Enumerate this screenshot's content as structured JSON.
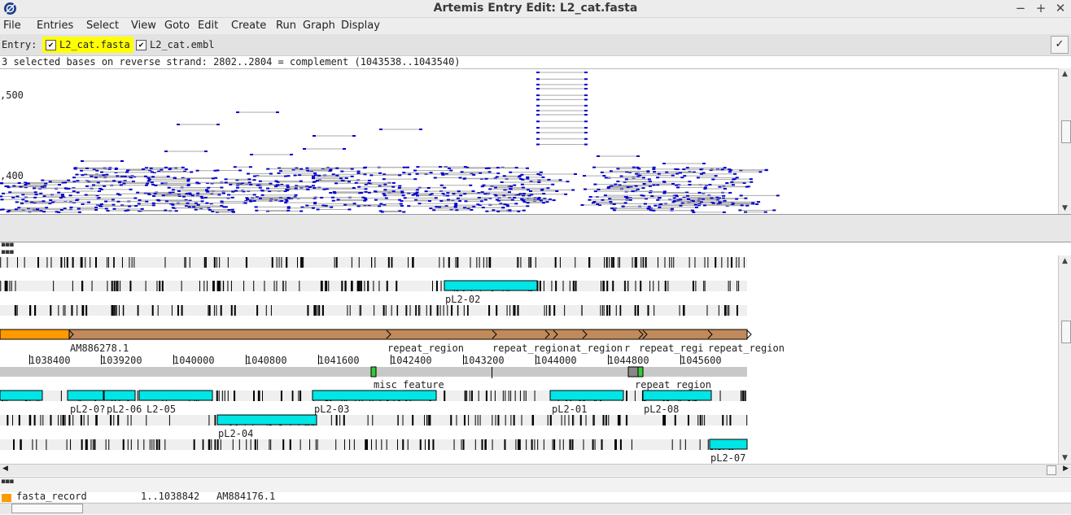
{
  "window": {
    "title": "Artemis Entry Edit: L2_cat.fasta",
    "controls": [
      "−",
      "+",
      "✕"
    ]
  },
  "menu": [
    "File",
    "Entries",
    "Select",
    "View",
    "Goto",
    "Edit",
    "Create",
    "Run",
    "Graph",
    "Display"
  ],
  "entry_bar": {
    "label": "Entry:",
    "entries": [
      {
        "name": "L2_cat.fasta",
        "checked": true,
        "highlight": "#ffff00"
      },
      {
        "name": "L2_cat.embl",
        "checked": true,
        "highlight": ""
      }
    ],
    "apply_icon": "✓"
  },
  "status": "3 selected bases on reverse strand: 2802..2804  = complement (1043538..1043540)",
  "graph": {
    "y_labels": [
      ",500",
      ",400"
    ],
    "read_color": "#0000cc",
    "read_line_color": "#aaaaaa"
  },
  "features": {
    "forward_labels": [
      "pL2-02"
    ],
    "repeat_track_labels": [
      "AM886278.1",
      "repeat_region",
      "repeat_region",
      "at_region",
      "r",
      "repeat_regi",
      "repeat_region"
    ],
    "ruler": [
      "1038400",
      "1039200",
      "1040000",
      "1040800",
      "1041600",
      "1042400",
      "1043200",
      "1044000",
      "1044800",
      "1045600"
    ],
    "reverse_labels": [
      "misc_feature",
      "repeat_region",
      "pL2-0?",
      "pL2-06",
      "L2-05",
      "pL2-03",
      "pL2-01",
      "pL2-08",
      "pL2-04",
      "pL2-07"
    ],
    "cds_color": "#00e5e5",
    "repeat_color": "#c08a5a",
    "fasta_color": "#ff9900",
    "misc_color": "#33cc33"
  },
  "record": {
    "key": "fasta_record",
    "location": "1..1038842",
    "name": "AM884176.1"
  }
}
